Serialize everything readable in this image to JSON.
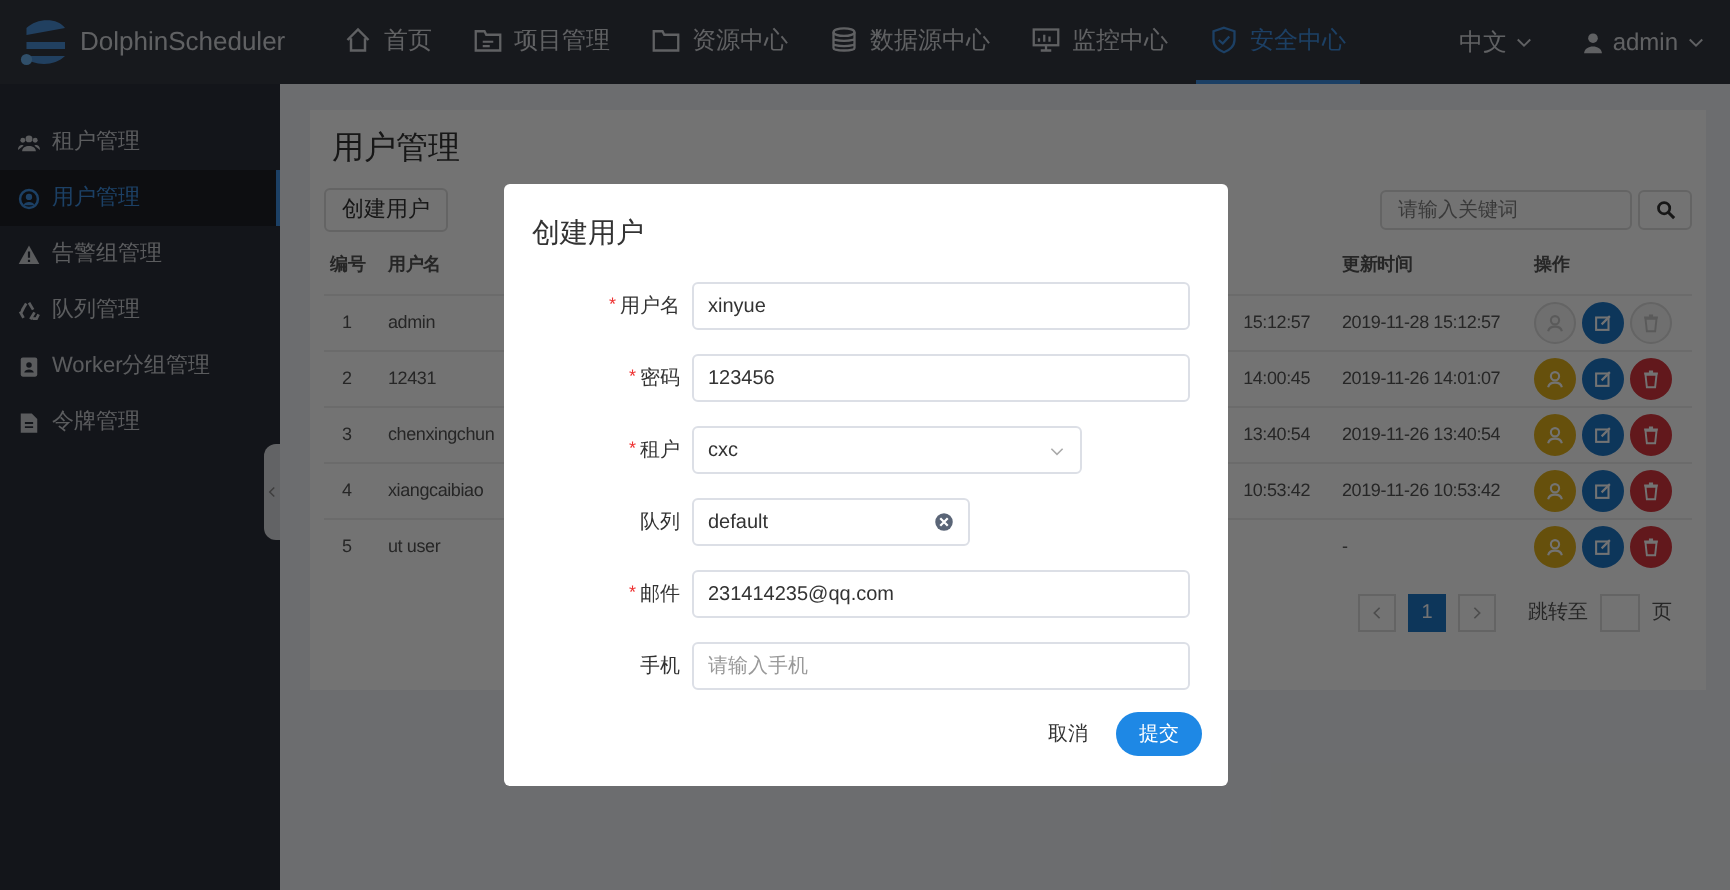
{
  "header": {
    "logo_text": "DolphinScheduler",
    "nav": [
      {
        "label": "首页",
        "selected": false
      },
      {
        "label": "项目管理",
        "selected": false
      },
      {
        "label": "资源中心",
        "selected": false
      },
      {
        "label": "数据源中心",
        "selected": false
      },
      {
        "label": "监控中心",
        "selected": false
      },
      {
        "label": "安全中心",
        "selected": true
      }
    ],
    "language": "中文",
    "user": "admin"
  },
  "sidebar": {
    "items": [
      {
        "label": "租户管理",
        "selected": false
      },
      {
        "label": "用户管理",
        "selected": true
      },
      {
        "label": "告警组管理",
        "selected": false
      },
      {
        "label": "队列管理",
        "selected": false
      },
      {
        "label": "Worker分组管理",
        "selected": false
      },
      {
        "label": "令牌管理",
        "selected": false
      }
    ]
  },
  "page": {
    "title": "用户管理",
    "create_button": "创建用户",
    "search": {
      "placeholder": "请输入关键词"
    },
    "table": {
      "columns": [
        "编号",
        "用户名",
        "更新时间",
        "操作"
      ],
      "rows": [
        {
          "id": "1",
          "name": "admin",
          "column_3": "15:12:57",
          "updated": "2019-11-28 15:12:57",
          "actions": [
            {
              "kind": "authorize",
              "disabled": true
            },
            {
              "kind": "edit",
              "disabled": false
            },
            {
              "kind": "delete",
              "disabled": true
            }
          ]
        },
        {
          "id": "2",
          "name": "12431",
          "column_3": "14:00:45",
          "updated": "2019-11-26 14:01:07",
          "actions": [
            {
              "kind": "authorize",
              "disabled": false
            },
            {
              "kind": "edit",
              "disabled": false
            },
            {
              "kind": "delete",
              "disabled": false
            }
          ]
        },
        {
          "id": "3",
          "name": "chenxingchun",
          "column_3": "13:40:54",
          "updated": "2019-11-26 13:40:54",
          "actions": [
            {
              "kind": "authorize",
              "disabled": false
            },
            {
              "kind": "edit",
              "disabled": false
            },
            {
              "kind": "delete",
              "disabled": false
            }
          ]
        },
        {
          "id": "4",
          "name": "xiangcaibiao",
          "column_3": "10:53:42",
          "updated": "2019-11-26 10:53:42",
          "actions": [
            {
              "kind": "authorize",
              "disabled": false
            },
            {
              "kind": "edit",
              "disabled": false
            },
            {
              "kind": "delete",
              "disabled": false
            }
          ]
        },
        {
          "id": "5",
          "name": "ut user",
          "column_3": "",
          "updated": "-",
          "actions": [
            {
              "kind": "authorize",
              "disabled": false
            },
            {
              "kind": "edit",
              "disabled": false
            },
            {
              "kind": "delete",
              "disabled": false
            }
          ]
        }
      ]
    },
    "pagination": {
      "pages": [
        {
          "label": "1",
          "selected": true
        }
      ],
      "jump_label": "跳转至",
      "page_unit": "页"
    }
  },
  "dialog": {
    "title": "创建用户",
    "fields": [
      {
        "label": "用户名",
        "required_mark": "*",
        "kind": "text",
        "value": "xinyue"
      },
      {
        "label": "密码",
        "required_mark": "*",
        "kind": "text",
        "value": "123456"
      },
      {
        "label": "租户",
        "required_mark": "*",
        "kind": "select",
        "value": "cxc"
      },
      {
        "label": "队列",
        "kind": "clearable",
        "value": "default"
      },
      {
        "label": "邮件",
        "required_mark": "*",
        "kind": "text",
        "value": "231414235@qq.com"
      },
      {
        "label": "手机",
        "kind": "text",
        "placeholder": "请输入手机"
      }
    ],
    "cancel": "取消",
    "submit": "提交"
  }
}
